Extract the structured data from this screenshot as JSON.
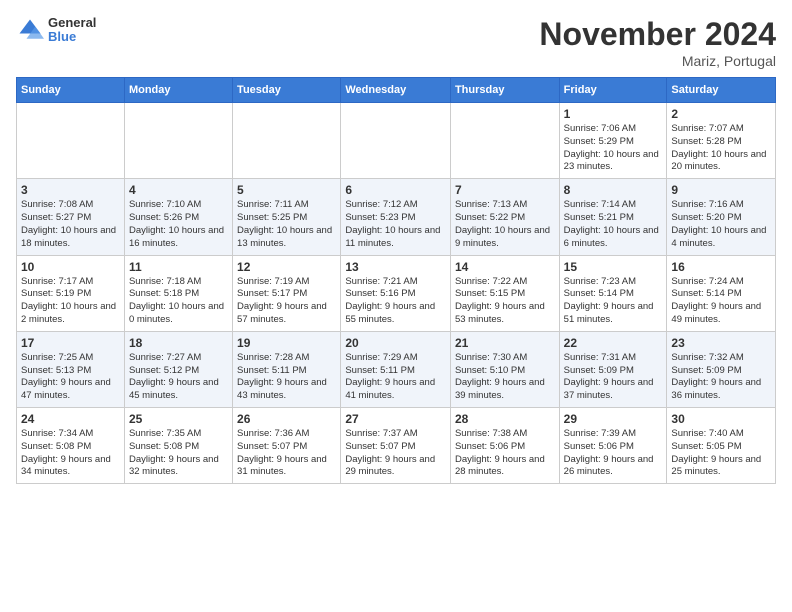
{
  "header": {
    "logo_general": "General",
    "logo_blue": "Blue",
    "month_title": "November 2024",
    "location": "Mariz, Portugal"
  },
  "weekdays": [
    "Sunday",
    "Monday",
    "Tuesday",
    "Wednesday",
    "Thursday",
    "Friday",
    "Saturday"
  ],
  "weeks": [
    [
      {
        "day": "",
        "info": ""
      },
      {
        "day": "",
        "info": ""
      },
      {
        "day": "",
        "info": ""
      },
      {
        "day": "",
        "info": ""
      },
      {
        "day": "",
        "info": ""
      },
      {
        "day": "1",
        "info": "Sunrise: 7:06 AM\nSunset: 5:29 PM\nDaylight: 10 hours and 23 minutes."
      },
      {
        "day": "2",
        "info": "Sunrise: 7:07 AM\nSunset: 5:28 PM\nDaylight: 10 hours and 20 minutes."
      }
    ],
    [
      {
        "day": "3",
        "info": "Sunrise: 7:08 AM\nSunset: 5:27 PM\nDaylight: 10 hours and 18 minutes."
      },
      {
        "day": "4",
        "info": "Sunrise: 7:10 AM\nSunset: 5:26 PM\nDaylight: 10 hours and 16 minutes."
      },
      {
        "day": "5",
        "info": "Sunrise: 7:11 AM\nSunset: 5:25 PM\nDaylight: 10 hours and 13 minutes."
      },
      {
        "day": "6",
        "info": "Sunrise: 7:12 AM\nSunset: 5:23 PM\nDaylight: 10 hours and 11 minutes."
      },
      {
        "day": "7",
        "info": "Sunrise: 7:13 AM\nSunset: 5:22 PM\nDaylight: 10 hours and 9 minutes."
      },
      {
        "day": "8",
        "info": "Sunrise: 7:14 AM\nSunset: 5:21 PM\nDaylight: 10 hours and 6 minutes."
      },
      {
        "day": "9",
        "info": "Sunrise: 7:16 AM\nSunset: 5:20 PM\nDaylight: 10 hours and 4 minutes."
      }
    ],
    [
      {
        "day": "10",
        "info": "Sunrise: 7:17 AM\nSunset: 5:19 PM\nDaylight: 10 hours and 2 minutes."
      },
      {
        "day": "11",
        "info": "Sunrise: 7:18 AM\nSunset: 5:18 PM\nDaylight: 10 hours and 0 minutes."
      },
      {
        "day": "12",
        "info": "Sunrise: 7:19 AM\nSunset: 5:17 PM\nDaylight: 9 hours and 57 minutes."
      },
      {
        "day": "13",
        "info": "Sunrise: 7:21 AM\nSunset: 5:16 PM\nDaylight: 9 hours and 55 minutes."
      },
      {
        "day": "14",
        "info": "Sunrise: 7:22 AM\nSunset: 5:15 PM\nDaylight: 9 hours and 53 minutes."
      },
      {
        "day": "15",
        "info": "Sunrise: 7:23 AM\nSunset: 5:14 PM\nDaylight: 9 hours and 51 minutes."
      },
      {
        "day": "16",
        "info": "Sunrise: 7:24 AM\nSunset: 5:14 PM\nDaylight: 9 hours and 49 minutes."
      }
    ],
    [
      {
        "day": "17",
        "info": "Sunrise: 7:25 AM\nSunset: 5:13 PM\nDaylight: 9 hours and 47 minutes."
      },
      {
        "day": "18",
        "info": "Sunrise: 7:27 AM\nSunset: 5:12 PM\nDaylight: 9 hours and 45 minutes."
      },
      {
        "day": "19",
        "info": "Sunrise: 7:28 AM\nSunset: 5:11 PM\nDaylight: 9 hours and 43 minutes."
      },
      {
        "day": "20",
        "info": "Sunrise: 7:29 AM\nSunset: 5:11 PM\nDaylight: 9 hours and 41 minutes."
      },
      {
        "day": "21",
        "info": "Sunrise: 7:30 AM\nSunset: 5:10 PM\nDaylight: 9 hours and 39 minutes."
      },
      {
        "day": "22",
        "info": "Sunrise: 7:31 AM\nSunset: 5:09 PM\nDaylight: 9 hours and 37 minutes."
      },
      {
        "day": "23",
        "info": "Sunrise: 7:32 AM\nSunset: 5:09 PM\nDaylight: 9 hours and 36 minutes."
      }
    ],
    [
      {
        "day": "24",
        "info": "Sunrise: 7:34 AM\nSunset: 5:08 PM\nDaylight: 9 hours and 34 minutes."
      },
      {
        "day": "25",
        "info": "Sunrise: 7:35 AM\nSunset: 5:08 PM\nDaylight: 9 hours and 32 minutes."
      },
      {
        "day": "26",
        "info": "Sunrise: 7:36 AM\nSunset: 5:07 PM\nDaylight: 9 hours and 31 minutes."
      },
      {
        "day": "27",
        "info": "Sunrise: 7:37 AM\nSunset: 5:07 PM\nDaylight: 9 hours and 29 minutes."
      },
      {
        "day": "28",
        "info": "Sunrise: 7:38 AM\nSunset: 5:06 PM\nDaylight: 9 hours and 28 minutes."
      },
      {
        "day": "29",
        "info": "Sunrise: 7:39 AM\nSunset: 5:06 PM\nDaylight: 9 hours and 26 minutes."
      },
      {
        "day": "30",
        "info": "Sunrise: 7:40 AM\nSunset: 5:05 PM\nDaylight: 9 hours and 25 minutes."
      }
    ]
  ]
}
